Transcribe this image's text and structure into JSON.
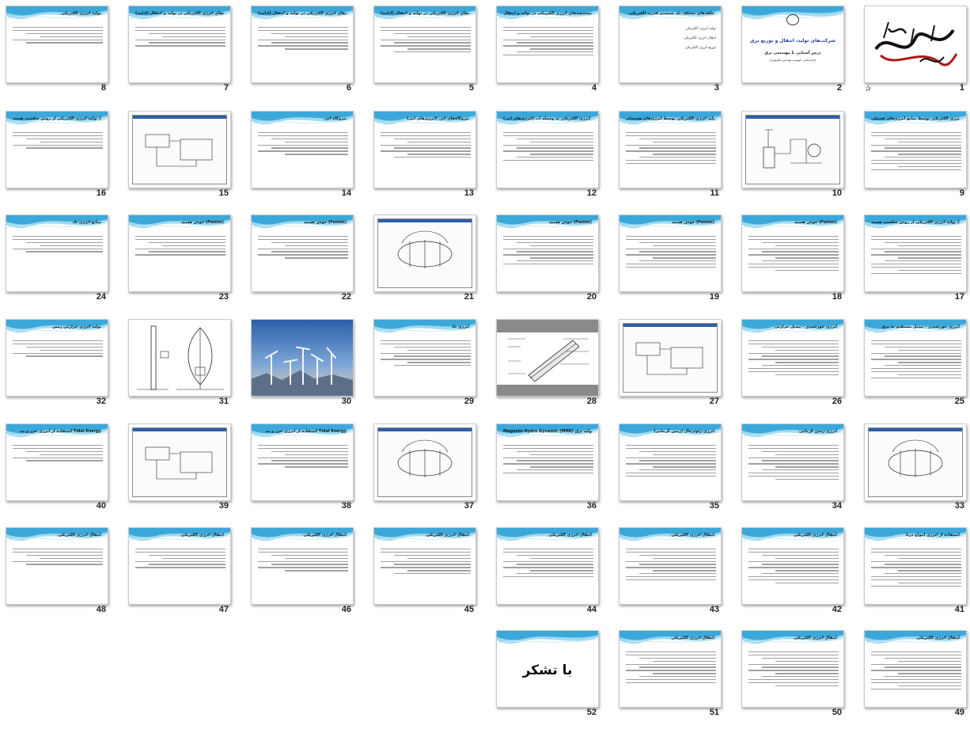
{
  "view": "slide-sorter",
  "colors": {
    "accent": "#2a9fd6",
    "wave": "#9fdaf0",
    "number": "#222222",
    "border": "#c9c9c9"
  },
  "slides": [
    {
      "n": "1",
      "kind": "calligraphy",
      "star": true
    },
    {
      "n": "2",
      "kind": "titlepage",
      "title": "شرکت‌های تولید، انتقال و توزیع برق",
      "subtitle": "درس آشنایی با مهندسی برق",
      "small": "(کارشناسی ناپیوسته مهندسی تکنولوژی)"
    },
    {
      "n": "3",
      "kind": "bullets",
      "title": "حلقه‌های مختلف یک سیستم قدرت الکتریکی",
      "items": [
        "تولید انرژی الکتریکی",
        "انتقال انرژی الکتریکی",
        "توزیع انرژی الکتریکی"
      ]
    },
    {
      "n": "4",
      "kind": "text",
      "title": "مشخصه‌های انرژی الکتریکی در تولید و انتقال"
    },
    {
      "n": "5",
      "kind": "text",
      "title": "مشخصه‌های انرژی الکتریکی در تولید و انتقال (ادامه)"
    },
    {
      "n": "6",
      "kind": "text",
      "title": "مشخصه‌های انرژی الکتریکی در تولید و انتقال (ادامه)"
    },
    {
      "n": "7",
      "kind": "text",
      "title": "مشخصه‌های انرژی الکتریکی در تولید و انتقال (ادامه)"
    },
    {
      "n": "8",
      "kind": "text",
      "title": "تولید انرژی الکتریکی"
    },
    {
      "n": "9",
      "kind": "text",
      "title": "تولید انرژی الکتریکی توسط منابع انرژی‌های فسیلی"
    },
    {
      "n": "10",
      "kind": "diagram"
    },
    {
      "n": "11",
      "kind": "text",
      "title": "تولید انرژی الکتریکی توسط انرژی‌های هسته‌ای"
    },
    {
      "n": "12",
      "kind": "text",
      "title": "تولید انرژی الکتریکی به وسیله آب (انرژی‌های آبی)"
    },
    {
      "n": "13",
      "kind": "text",
      "title": "نیروگاه‌های آبی (انرژی‌های آبی)"
    },
    {
      "n": "14",
      "kind": "text",
      "title": "نیروگاه آبی"
    },
    {
      "n": "15",
      "kind": "screenshot"
    },
    {
      "n": "16",
      "kind": "text",
      "title": "تولید انرژی الکتریکی از روش شکست هسته (Fission)"
    },
    {
      "n": "17",
      "kind": "text",
      "title": "تولید انرژی الکتریکی از روش شکست هسته (Fission) – ادامه"
    },
    {
      "n": "18",
      "kind": "text",
      "title": "جوش هسته (Fusion)"
    },
    {
      "n": "19",
      "kind": "text",
      "title": "جوش هسته (Fusion)"
    },
    {
      "n": "20",
      "kind": "text",
      "title": "جوش هسته (Fusion)"
    },
    {
      "n": "21",
      "kind": "screenshot"
    },
    {
      "n": "22",
      "kind": "text",
      "title": "جوش هسته (Fusion)"
    },
    {
      "n": "23",
      "kind": "text",
      "title": "جوش هسته (Fusion)"
    },
    {
      "n": "24",
      "kind": "text",
      "title": "منابع انرژی باد"
    },
    {
      "n": "25",
      "kind": "text",
      "title": "انرژی خورشیدی – تبدیل مستقیم به برق"
    },
    {
      "n": "26",
      "kind": "text",
      "title": "انرژی خورشیدی – تبدیل حرارتی"
    },
    {
      "n": "27",
      "kind": "screenshot"
    },
    {
      "n": "28",
      "kind": "greydiagram"
    },
    {
      "n": "29",
      "kind": "text",
      "title": "انرژی باد"
    },
    {
      "n": "30",
      "kind": "photo"
    },
    {
      "n": "31",
      "kind": "linediagram"
    },
    {
      "n": "32",
      "kind": "text",
      "title": "تولید انرژی حرارتی زمین"
    },
    {
      "n": "33",
      "kind": "screenshot"
    },
    {
      "n": "34",
      "kind": "text",
      "title": "انرژی زمین گرمایی"
    },
    {
      "n": "35",
      "kind": "text",
      "title": "انرژی ژئوترمال (زمین گرمایی)"
    },
    {
      "n": "36",
      "kind": "text",
      "title": "Magneto Hydro Dynamic (MHD) تولید برق"
    },
    {
      "n": "37",
      "kind": "screenshot"
    },
    {
      "n": "38",
      "kind": "text",
      "title": "استفاده از انرژی جزر و مد Tidal Energy"
    },
    {
      "n": "39",
      "kind": "screenshot"
    },
    {
      "n": "40",
      "kind": "text",
      "title": "استفاده از انرژی جزر و مد Tidal Energy"
    },
    {
      "n": "41",
      "kind": "text",
      "title": "استفاده از انرژی امواج دریا"
    },
    {
      "n": "42",
      "kind": "text",
      "title": "انتقال انرژی الکتریکی"
    },
    {
      "n": "43",
      "kind": "text",
      "title": "انتقال انرژی الکتریکی"
    },
    {
      "n": "44",
      "kind": "text",
      "title": "انتقال انرژی الکتریکی"
    },
    {
      "n": "45",
      "kind": "text",
      "title": "انتقال انرژی الکتریکی"
    },
    {
      "n": "46",
      "kind": "text",
      "title": "انتقال انرژی الکتریکی"
    },
    {
      "n": "47",
      "kind": "text",
      "title": "انتقال انرژی الکتریکی"
    },
    {
      "n": "48",
      "kind": "text",
      "title": "انتقال انرژی الکتریکی"
    },
    {
      "n": "49",
      "kind": "text",
      "title": "انتقال انرژی الکتریکی"
    },
    {
      "n": "50",
      "kind": "text",
      "title": "انتقال انرژی الکتریکی"
    },
    {
      "n": "51",
      "kind": "text",
      "title": "انتقال انرژی الکتریکی"
    },
    {
      "n": "52",
      "kind": "thanks",
      "text": "با تشکر"
    }
  ]
}
